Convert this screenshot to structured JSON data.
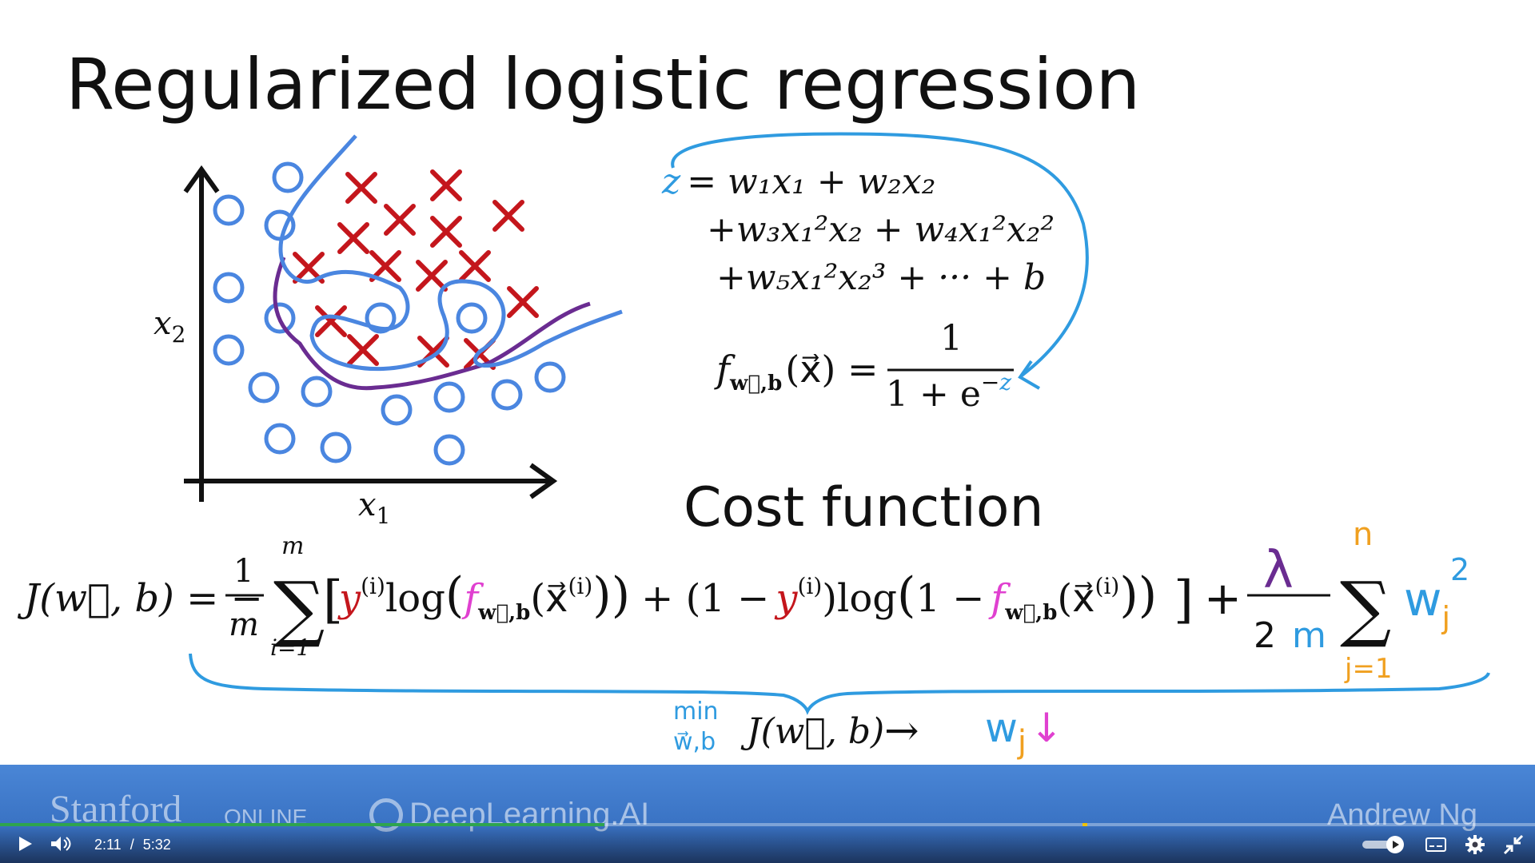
{
  "slide": {
    "title": "Regularized logistic regression",
    "subtitle": "Cost function",
    "axis_x_label": "x",
    "axis_x_sub": "1",
    "axis_y_label": "x",
    "axis_y_sub": "2",
    "equation_z": {
      "z_var": "z",
      "line1": "= w₁x₁ + w₂x₂",
      "line2": "+w₃x₁²x₂ + w₄x₁²x₂²",
      "line3": "+w₅x₁²x₂³ + ··· + b"
    },
    "equation_f": {
      "lhs": "f",
      "lhs_sub": "w⃗,b",
      "lhs_arg": "(x⃗) =",
      "numerator": "1",
      "denominator_base": "1 + e",
      "denominator_exp_sign": "−",
      "denominator_exp_var": "z"
    },
    "cost": {
      "J": "J(w⃗, b) = −",
      "frac_num": "1",
      "frac_den": "m",
      "sum_top": "m",
      "sum_bottom": "i=1",
      "bracket_open": "[",
      "y1": "y",
      "sup_i": "(i)",
      "log1": "log",
      "f1": "f",
      "fsub": "w⃗,b",
      "xarg": "(x⃗",
      "middle": "+ (1 −",
      "log2": "log",
      "one_minus": "1 −",
      "bracket_close": "]",
      "plus": "+",
      "lambda": "λ",
      "two": "2",
      "m2": "m",
      "sum2_top": "n",
      "sum2_bottom": "j=1",
      "w": "w",
      "j": "j",
      "sq": "2"
    },
    "minimize": {
      "min": "min",
      "under": "w⃗,b",
      "expr": "J(w⃗, b)",
      "arrow": "→",
      "w": "w",
      "j": "j",
      "down": "↓"
    }
  },
  "banner": {
    "stanford": "Stanford",
    "online": "ONLINE",
    "deeplearning": "DeepLearning.AI",
    "instructor": "Andrew Ng"
  },
  "player": {
    "current_time": "2:11",
    "separator": "/",
    "duration": "5:32",
    "progress": 0.394,
    "marker": 0.705
  },
  "colors": {
    "blue": "#2f9be0",
    "circle_blue": "#4a86e0",
    "red": "#c4161c",
    "purple": "#6a2c91",
    "magenta": "#e040d0",
    "orange": "#f0a020",
    "green": "#2ea44f"
  }
}
